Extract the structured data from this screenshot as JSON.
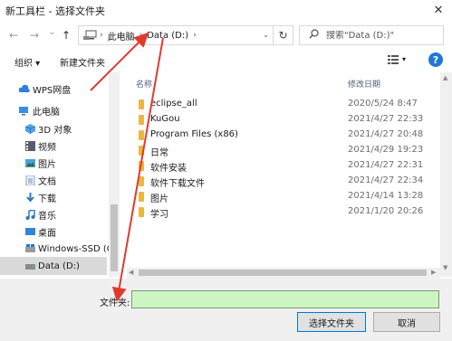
{
  "window": {
    "title": "新工具栏 - 选择文件夹",
    "close_glyph": "✕"
  },
  "nav": {
    "back": "←",
    "forward": "→",
    "dropdown": "⌄",
    "up": "↑"
  },
  "address": {
    "segments": [
      "此电脑",
      "Data (D:)"
    ],
    "separator": "›",
    "refresh": "↻"
  },
  "search": {
    "placeholder": "搜索\"Data (D:)\""
  },
  "toolbar": {
    "organize": "组织 ▾",
    "new_folder": "新建文件夹"
  },
  "sidebar": {
    "items": [
      {
        "label": "WPS网盘",
        "icon": "cloud-icon"
      },
      {
        "label": "此电脑",
        "icon": "computer-icon"
      },
      {
        "label": "3D 对象",
        "icon": "cube-icon"
      },
      {
        "label": "视频",
        "icon": "video-icon"
      },
      {
        "label": "图片",
        "icon": "picture-icon"
      },
      {
        "label": "文档",
        "icon": "document-icon"
      },
      {
        "label": "下载",
        "icon": "download-icon"
      },
      {
        "label": "音乐",
        "icon": "music-icon"
      },
      {
        "label": "桌面",
        "icon": "desktop-icon"
      },
      {
        "label": "Windows-SSD (C",
        "icon": "drive-icon"
      },
      {
        "label": "Data (D:)",
        "icon": "drive-icon",
        "selected": true
      }
    ]
  },
  "columns": {
    "name": "名称",
    "modified": "修改日期"
  },
  "files": [
    {
      "name": "eclipse_all",
      "date": "2020/5/24 8:47"
    },
    {
      "name": "KuGou",
      "date": "2021/4/27 22:33"
    },
    {
      "name": "Program Files (x86)",
      "date": "2021/4/27 20:48"
    },
    {
      "name": "日常",
      "date": "2021/4/29 19:23"
    },
    {
      "name": "软件安装",
      "date": "2021/4/27 22:31"
    },
    {
      "name": "软件下载文件",
      "date": "2021/4/27 22:34"
    },
    {
      "name": "图片",
      "date": "2021/4/14 13:28"
    },
    {
      "name": "学习",
      "date": "2021/1/20 20:26"
    }
  ],
  "footer": {
    "folder_label": "文件夹:",
    "folder_value": "",
    "select_button": "选择文件夹",
    "cancel_button": "取消"
  },
  "colors": {
    "accent": "#1e78d6",
    "folder": "#e9b843",
    "input_highlight": "#cdf5c1",
    "annotation_arrow": "#e03a2f"
  }
}
